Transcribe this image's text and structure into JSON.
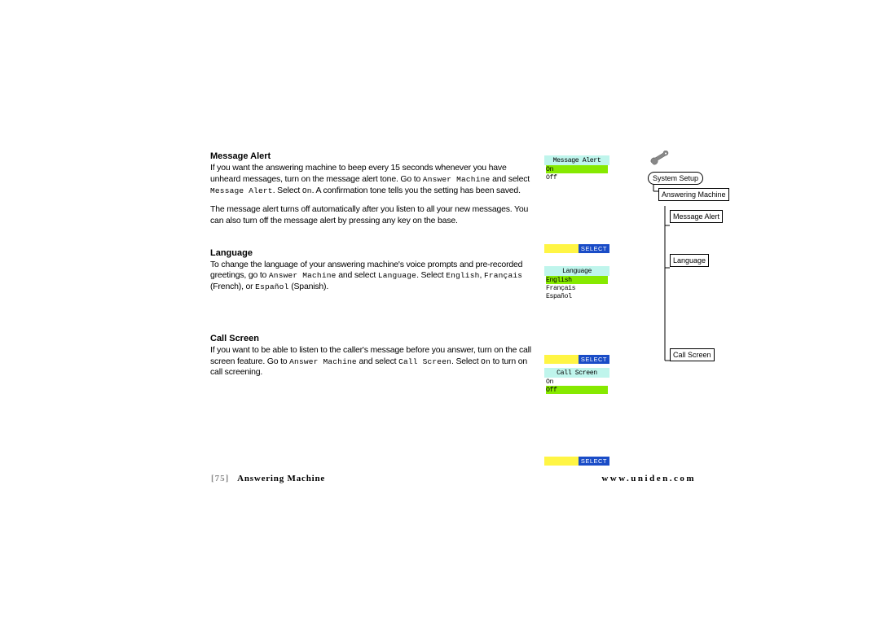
{
  "sections": {
    "msgalert": {
      "heading": "Message Alert",
      "p1a": "If you want the answering machine to beep every 15 seconds whenever you have unheard messages, turn on the message alert tone. Go to ",
      "m1": "Answer Machine",
      "p1b": " and select ",
      "m2": "Message Alert",
      "p1c": ". Select ",
      "m3": "On",
      "p1d": ". A confirmation tone tells you the setting has been saved.",
      "p2": "The message alert turns off automatically after you listen to all your new messages. You can also turn off the message alert by pressing any key on the base."
    },
    "lang": {
      "heading": "Language",
      "p1a": "To change the language of your answering machine's voice prompts and pre-recorded greetings, go to ",
      "m1": "Answer Machine",
      "p1b": " and select ",
      "m2": "Language",
      "p1c": ". Select ",
      "m3": "English",
      "p1d": ", ",
      "m4": "Français",
      "p1e": " (French), or ",
      "m5": "Español",
      "p1f": " (Spanish)."
    },
    "callscr": {
      "heading": "Call Screen",
      "p1a": "If you want to be able to listen to the caller's message before you answer, turn on the call screen feature. Go to ",
      "m1": "Answer Machine",
      "p1b": " and select ",
      "m2": "Call Screen",
      "p1c": ". Select ",
      "m3": "On",
      "p1d": " to turn on call screening."
    }
  },
  "screens": {
    "s1": {
      "title": "Message Alert",
      "opt1": "On",
      "opt2": "Off",
      "select": "SELECT"
    },
    "s2": {
      "title": "Language",
      "opt1": "English",
      "opt2": "Français",
      "opt3": "Español",
      "select": "SELECT"
    },
    "s3": {
      "title": "Call Screen",
      "opt1": "On",
      "opt2": "Off",
      "select": "SELECT"
    }
  },
  "nav": {
    "root": "System Setup",
    "n1": "Answering Machine",
    "n2": "Message Alert",
    "n3": "Language",
    "n4": "Call Screen"
  },
  "footer": {
    "page": "[75]",
    "section": "Answering Machine",
    "url": "www.uniden.com"
  }
}
